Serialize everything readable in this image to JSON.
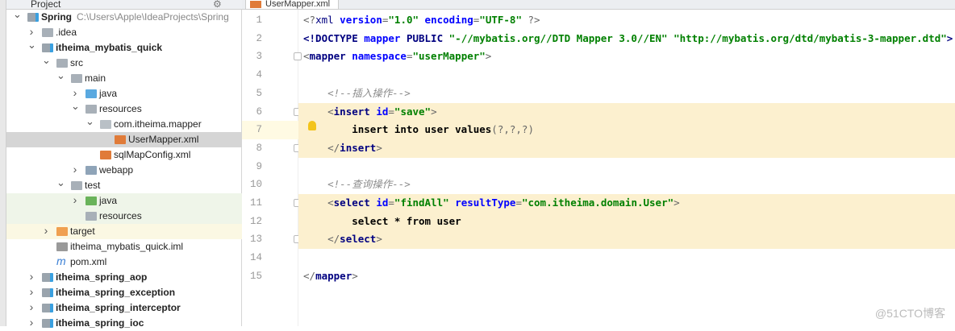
{
  "project_panel": {
    "title": "Project",
    "gear": "⚙"
  },
  "tree": [
    {
      "label": "Spring",
      "path": "C:\\Users\\Apple\\IdeaProjects\\Spring",
      "level": 0,
      "arrow": "open",
      "icon": "module",
      "bold": true
    },
    {
      "label": ".idea",
      "level": 1,
      "arrow": "closed",
      "icon": "folder"
    },
    {
      "label": "itheima_mybatis_quick",
      "level": 1,
      "arrow": "open",
      "icon": "module",
      "bold": true
    },
    {
      "label": "src",
      "level": 2,
      "arrow": "open",
      "icon": "folder"
    },
    {
      "label": "main",
      "level": 3,
      "arrow": "open",
      "icon": "folder"
    },
    {
      "label": "java",
      "level": 4,
      "arrow": "closed",
      "icon": "src-folder"
    },
    {
      "label": "resources",
      "level": 4,
      "arrow": "open",
      "icon": "res-folder"
    },
    {
      "label": "com.itheima.mapper",
      "level": 5,
      "arrow": "open",
      "icon": "package"
    },
    {
      "label": "UserMapper.xml",
      "level": 6,
      "arrow": "none",
      "icon": "xml",
      "selected": true
    },
    {
      "label": "sqlMapConfig.xml",
      "level": 5,
      "arrow": "none",
      "icon": "xml"
    },
    {
      "label": "webapp",
      "level": 4,
      "arrow": "closed",
      "icon": "web-folder"
    },
    {
      "label": "test",
      "level": 3,
      "arrow": "open",
      "icon": "folder"
    },
    {
      "label": "java",
      "level": 4,
      "arrow": "closed",
      "icon": "test-folder",
      "bg": "test"
    },
    {
      "label": "resources",
      "level": 4,
      "arrow": "none",
      "icon": "res-folder",
      "bg": "test"
    },
    {
      "label": "target",
      "level": 2,
      "arrow": "closed",
      "icon": "excluded-folder",
      "bg": "excl"
    },
    {
      "label": "itheima_mybatis_quick.iml",
      "level": 2,
      "arrow": "none",
      "icon": "iml"
    },
    {
      "label": "pom.xml",
      "level": 2,
      "arrow": "none",
      "icon": "maven"
    },
    {
      "label": "itheima_spring_aop",
      "level": 1,
      "arrow": "closed",
      "icon": "module",
      "bold": true
    },
    {
      "label": "itheima_spring_exception",
      "level": 1,
      "arrow": "closed",
      "icon": "module",
      "bold": true
    },
    {
      "label": "itheima_spring_interceptor",
      "level": 1,
      "arrow": "closed",
      "icon": "module",
      "bold": true
    },
    {
      "label": "itheima_spring_ioc",
      "level": 1,
      "arrow": "closed",
      "icon": "module",
      "bold": true
    }
  ],
  "editor": {
    "tab": "UserMapper.xml",
    "current_line": 7,
    "highlighted_lines": [
      6,
      7,
      8,
      11,
      12,
      13
    ],
    "lines": [
      [
        [
          "pun",
          "<?"
        ],
        [
          "pi",
          "xml "
        ],
        [
          "attr",
          "version"
        ],
        [
          "pun",
          "="
        ],
        [
          "str",
          "\"1.0\" "
        ],
        [
          "attr",
          "encoding"
        ],
        [
          "pun",
          "="
        ],
        [
          "str",
          "\"UTF-8\" "
        ],
        [
          "pun",
          "?>"
        ]
      ],
      [
        [
          "tag",
          "<!DOCTYPE "
        ],
        [
          "attr",
          "mapper "
        ],
        [
          "tag",
          "PUBLIC "
        ],
        [
          "str",
          "\"-//mybatis.org//DTD Mapper 3.0//EN\" \"http://mybatis.org/dtd/mybatis-3-mapper.dtd\""
        ],
        [
          "tag",
          ">"
        ]
      ],
      [
        [
          "pun",
          "<"
        ],
        [
          "tag",
          "mapper "
        ],
        [
          "attr",
          "namespace"
        ],
        [
          "pun",
          "="
        ],
        [
          "str",
          "\"userMapper\""
        ],
        [
          "pun",
          ">"
        ]
      ],
      [],
      [
        [
          "txt",
          "    "
        ],
        [
          "cmt",
          "<!--插入操作-->"
        ]
      ],
      [
        [
          "txt",
          "    "
        ],
        [
          "pun",
          "<"
        ],
        [
          "tag",
          "insert "
        ],
        [
          "attr",
          "id"
        ],
        [
          "pun",
          "="
        ],
        [
          "str",
          "\"save\""
        ],
        [
          "pun",
          ">"
        ]
      ],
      [
        [
          "txt",
          "        insert into user values"
        ],
        [
          "pun",
          "(?,?,?)"
        ]
      ],
      [
        [
          "txt",
          "    "
        ],
        [
          "pun",
          "</"
        ],
        [
          "tag",
          "insert"
        ],
        [
          "pun",
          ">"
        ]
      ],
      [],
      [
        [
          "txt",
          "    "
        ],
        [
          "cmt",
          "<!--查询操作-->"
        ]
      ],
      [
        [
          "txt",
          "    "
        ],
        [
          "pun",
          "<"
        ],
        [
          "tag",
          "select "
        ],
        [
          "attr",
          "id"
        ],
        [
          "pun",
          "="
        ],
        [
          "str",
          "\"findAll\" "
        ],
        [
          "attr",
          "resultType"
        ],
        [
          "pun",
          "="
        ],
        [
          "str",
          "\"com.itheima.domain.User\""
        ],
        [
          "pun",
          ">"
        ]
      ],
      [
        [
          "txt",
          "        select * from user"
        ]
      ],
      [
        [
          "txt",
          "    "
        ],
        [
          "pun",
          "</"
        ],
        [
          "tag",
          "select"
        ],
        [
          "pun",
          ">"
        ]
      ],
      [],
      [
        [
          "pun",
          "</"
        ],
        [
          "tag",
          "mapper"
        ],
        [
          "pun",
          ">"
        ]
      ]
    ]
  },
  "watermark": "@51CTO博客",
  "colors": {
    "highlight": "#fcf0cf",
    "selection": "#d5d5d5",
    "tag": "#000080",
    "attr": "#0000ff",
    "string": "#008000"
  }
}
